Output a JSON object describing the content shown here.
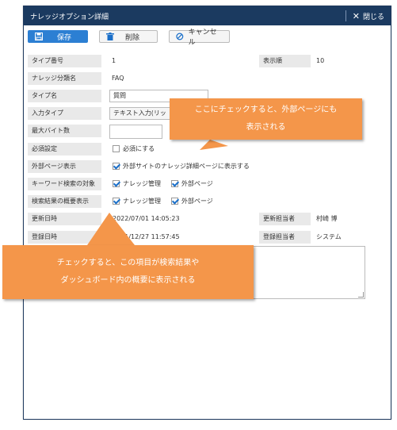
{
  "dialog": {
    "title": "ナレッジオプション詳細",
    "close_label": "閉じる"
  },
  "toolbar": {
    "save_label": "保存",
    "delete_label": "削除",
    "cancel_label": "キャンセル"
  },
  "fields": {
    "type_no": {
      "label": "タイプ番号",
      "value": "1"
    },
    "display_order": {
      "label": "表示順",
      "value": "10"
    },
    "category_name": {
      "label": "ナレッジ分類名",
      "value": "FAQ"
    },
    "type_name": {
      "label": "タイプ名",
      "value": "質問"
    },
    "input_type": {
      "label": "入力タイプ",
      "value": "テキスト入力(リッ"
    },
    "max_bytes": {
      "label": "最大バイト数",
      "value": ""
    },
    "required": {
      "label": "必須設定",
      "option": "必須にする",
      "checked": false
    },
    "external_page": {
      "label": "外部ページ表示",
      "option": "外部サイトのナレッジ詳細ページに表示する",
      "checked": true
    },
    "keyword_target": {
      "label": "キーワード検索の対象",
      "options": [
        {
          "label": "ナレッジ管理",
          "checked": true
        },
        {
          "label": "外部ページ",
          "checked": true
        }
      ]
    },
    "summary_display": {
      "label": "検索結果の概要表示",
      "options": [
        {
          "label": "ナレッジ管理",
          "checked": true
        },
        {
          "label": "外部ページ",
          "checked": true
        }
      ]
    },
    "updated_at": {
      "label": "更新日時",
      "value": "2022/07/01 14:05:23"
    },
    "updated_by": {
      "label": "更新担当者",
      "value": "村崎 博"
    },
    "created_at": {
      "label": "登録日時",
      "value": "2021/12/27 11:57:45"
    },
    "created_by": {
      "label": "登録担当者",
      "value": "システム"
    }
  },
  "callouts": {
    "top": [
      "ここにチェックすると、外部ページにも",
      "表示される"
    ],
    "bottom": [
      "チェックすると、この項目が検索結果や",
      "ダッシュボード内の概要に表示される"
    ]
  },
  "colors": {
    "titlebar": "#1b3a60",
    "primary": "#2c7fd3",
    "callout": "#f4964a"
  }
}
